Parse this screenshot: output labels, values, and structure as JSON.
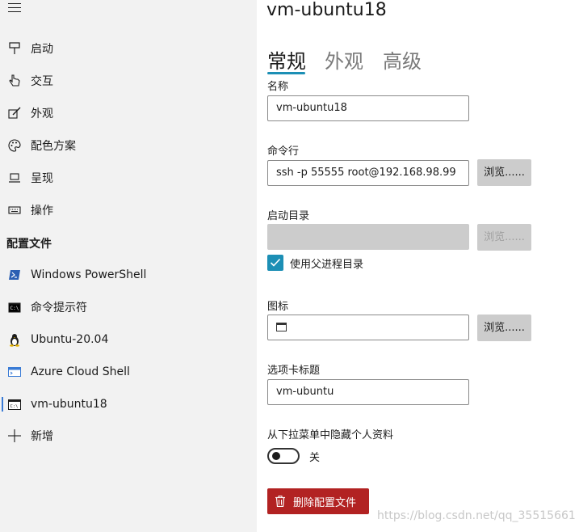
{
  "sidebar": {
    "menu_items": [
      {
        "label": "启动",
        "icon": "pin-icon"
      },
      {
        "label": "交互",
        "icon": "hand-pointer-icon"
      },
      {
        "label": "外观",
        "icon": "edit-icon"
      },
      {
        "label": "配色方案",
        "icon": "palette-icon"
      },
      {
        "label": "呈现",
        "icon": "monitor-icon"
      },
      {
        "label": "操作",
        "icon": "keyboard-icon"
      }
    ],
    "profiles_header": "配置文件",
    "profiles": [
      {
        "label": "Windows PowerShell",
        "icon": "powershell-icon"
      },
      {
        "label": "命令提示符",
        "icon": "cmd-icon"
      },
      {
        "label": "Ubuntu-20.04",
        "icon": "tux-icon"
      },
      {
        "label": "Azure Cloud Shell",
        "icon": "azure-cloud-shell-icon"
      },
      {
        "label": "vm-ubuntu18",
        "icon": "terminal-icon",
        "selected": true
      },
      {
        "label": "新增",
        "icon": "plus-icon"
      }
    ]
  },
  "main": {
    "title": "vm-ubuntu18",
    "tabs": [
      {
        "label": "常规",
        "active": true
      },
      {
        "label": "外观",
        "active": false
      },
      {
        "label": "高级",
        "active": false
      }
    ],
    "name": {
      "label": "名称",
      "value": "vm-ubuntu18"
    },
    "command_line": {
      "label": "命令行",
      "value": "ssh -p 55555 root@192.168.98.99",
      "browse_label": "浏览......"
    },
    "starting_directory": {
      "label": "启动目录",
      "value": "",
      "browse_label": "浏览......",
      "use_parent_label": "使用父进程目录",
      "use_parent_checked": true
    },
    "icon": {
      "label": "图标",
      "browse_label": "浏览......"
    },
    "tab_title": {
      "label": "选项卡标题",
      "value": "vm-ubuntu"
    },
    "hide_profile": {
      "label": "从下拉菜单中隐藏个人资料",
      "state_label": "关",
      "on": false
    },
    "delete_label": "删除配置文件"
  },
  "watermark": "https://blog.csdn.net/qq_35515661",
  "colors": {
    "accent": "#1c8fb5",
    "delete": "#b22222",
    "sidebar_bg": "#f2f2f2",
    "button_bg": "#cccccc"
  }
}
